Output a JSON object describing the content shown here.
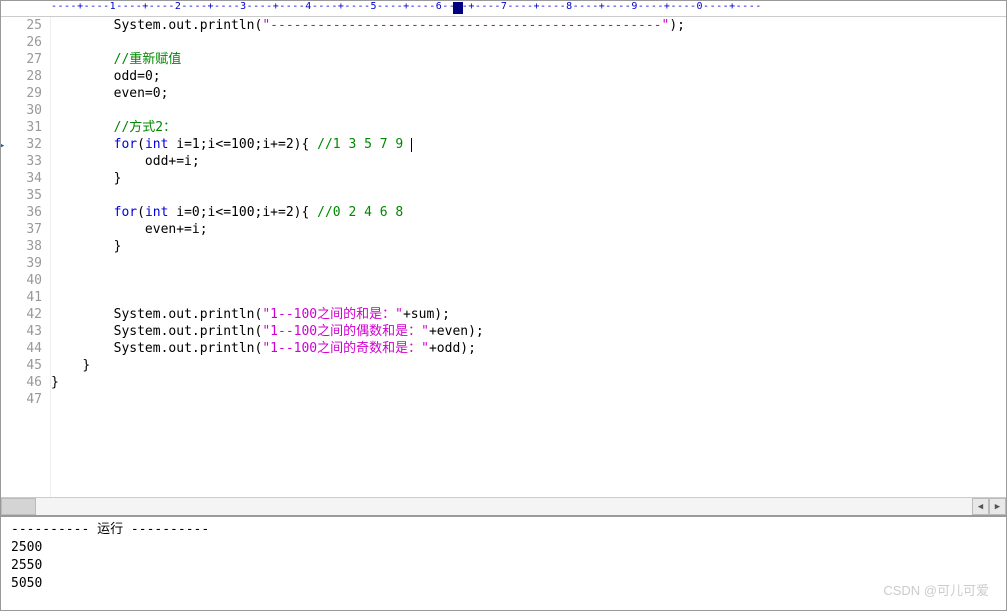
{
  "ruler": "----+----1----+----2----+----3----+----4----+----5----+----6----+----7----+----8----+----9----+----0----+----",
  "lines": [
    {
      "no": "25",
      "indent": "        ",
      "tokens": [
        {
          "t": "System.out.println(",
          "c": ""
        },
        {
          "t": "\"--------------------------------------------------\"",
          "c": "str"
        },
        {
          "t": ");",
          "c": ""
        }
      ]
    },
    {
      "no": "26",
      "indent": "",
      "tokens": []
    },
    {
      "no": "27",
      "indent": "        ",
      "tokens": [
        {
          "t": "//重新赋值",
          "c": "cmt"
        }
      ]
    },
    {
      "no": "28",
      "indent": "        ",
      "tokens": [
        {
          "t": "odd=",
          "c": ""
        },
        {
          "t": "0",
          "c": "num"
        },
        {
          "t": ";",
          "c": ""
        }
      ]
    },
    {
      "no": "29",
      "indent": "        ",
      "tokens": [
        {
          "t": "even=",
          "c": ""
        },
        {
          "t": "0",
          "c": "num"
        },
        {
          "t": ";",
          "c": ""
        }
      ]
    },
    {
      "no": "30",
      "indent": "",
      "tokens": []
    },
    {
      "no": "31",
      "indent": "        ",
      "tokens": [
        {
          "t": "//方式2：",
          "c": "cmt"
        }
      ]
    },
    {
      "no": "32",
      "arrow": true,
      "cursor": true,
      "indent": "        ",
      "tokens": [
        {
          "t": "for",
          "c": "kw"
        },
        {
          "t": "(",
          "c": ""
        },
        {
          "t": "int",
          "c": "kw"
        },
        {
          "t": " i=",
          "c": ""
        },
        {
          "t": "1",
          "c": "num"
        },
        {
          "t": ";i<=",
          "c": ""
        },
        {
          "t": "100",
          "c": "num"
        },
        {
          "t": ";i+=",
          "c": ""
        },
        {
          "t": "2",
          "c": "num"
        },
        {
          "t": "){ ",
          "c": ""
        },
        {
          "t": "//1 3 5 7 9 ",
          "c": "cmt"
        }
      ]
    },
    {
      "no": "33",
      "indent": "            ",
      "tokens": [
        {
          "t": "odd+=i;",
          "c": ""
        }
      ]
    },
    {
      "no": "34",
      "indent": "        ",
      "tokens": [
        {
          "t": "}",
          "c": ""
        }
      ]
    },
    {
      "no": "35",
      "indent": "",
      "tokens": []
    },
    {
      "no": "36",
      "indent": "        ",
      "tokens": [
        {
          "t": "for",
          "c": "kw"
        },
        {
          "t": "(",
          "c": ""
        },
        {
          "t": "int",
          "c": "kw"
        },
        {
          "t": " i=",
          "c": ""
        },
        {
          "t": "0",
          "c": "num"
        },
        {
          "t": ";i<=",
          "c": ""
        },
        {
          "t": "100",
          "c": "num"
        },
        {
          "t": ";i+=",
          "c": ""
        },
        {
          "t": "2",
          "c": "num"
        },
        {
          "t": "){ ",
          "c": ""
        },
        {
          "t": "//0 2 4 6 8",
          "c": "cmt"
        }
      ]
    },
    {
      "no": "37",
      "indent": "            ",
      "tokens": [
        {
          "t": "even+=i;",
          "c": ""
        }
      ]
    },
    {
      "no": "38",
      "indent": "        ",
      "tokens": [
        {
          "t": "}",
          "c": ""
        }
      ]
    },
    {
      "no": "39",
      "indent": "",
      "tokens": []
    },
    {
      "no": "40",
      "indent": "",
      "tokens": []
    },
    {
      "no": "41",
      "indent": "",
      "tokens": []
    },
    {
      "no": "42",
      "indent": "        ",
      "tokens": [
        {
          "t": "System.out.println(",
          "c": ""
        },
        {
          "t": "\"1--100之间的和是：\"",
          "c": "str"
        },
        {
          "t": "+sum);",
          "c": ""
        }
      ]
    },
    {
      "no": "43",
      "indent": "        ",
      "tokens": [
        {
          "t": "System.out.println(",
          "c": ""
        },
        {
          "t": "\"1--100之间的偶数和是：\"",
          "c": "str"
        },
        {
          "t": "+even);",
          "c": ""
        }
      ]
    },
    {
      "no": "44",
      "indent": "        ",
      "tokens": [
        {
          "t": "System.out.println(",
          "c": ""
        },
        {
          "t": "\"1--100之间的奇数和是：\"",
          "c": "str"
        },
        {
          "t": "+odd);",
          "c": ""
        }
      ]
    },
    {
      "no": "45",
      "indent": "    ",
      "tokens": [
        {
          "t": "}",
          "c": ""
        }
      ]
    },
    {
      "no": "46",
      "indent": "",
      "tokens": [
        {
          "t": "}",
          "c": ""
        }
      ]
    },
    {
      "no": "47",
      "indent": "",
      "tokens": []
    }
  ],
  "output": {
    "header": "---------- 运行 ----------",
    "lines": [
      "2500",
      "2550",
      "5050"
    ]
  },
  "watermark": "CSDN @可儿可爱"
}
